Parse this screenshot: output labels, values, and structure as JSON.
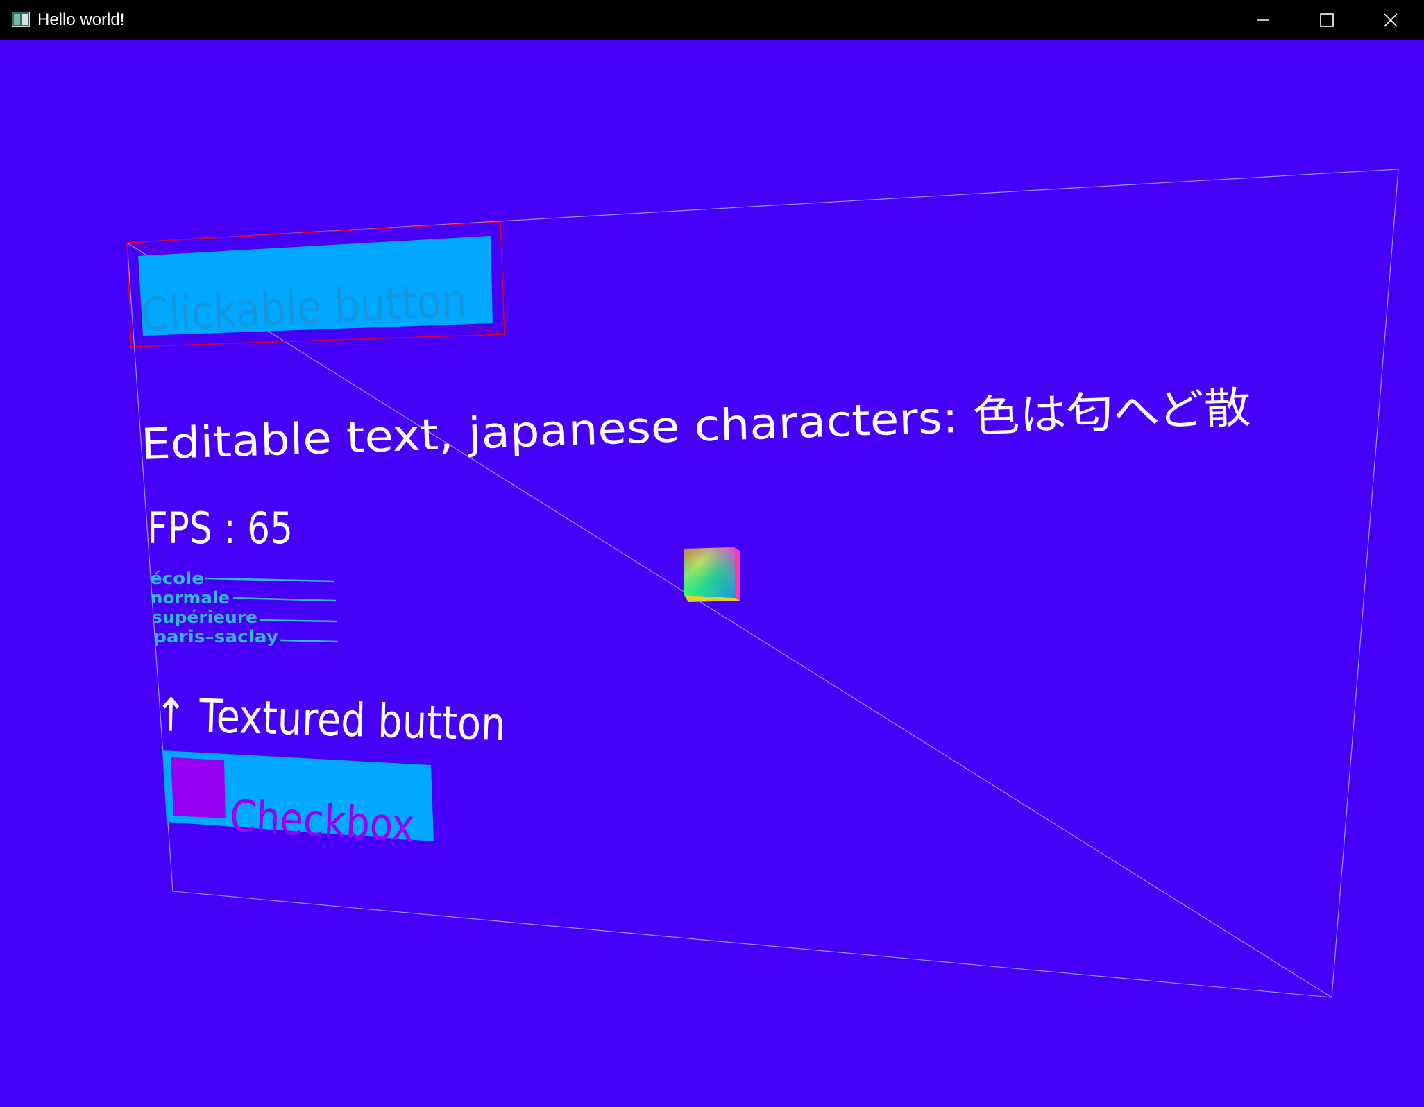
{
  "window": {
    "title": "Hello world!",
    "controls": {
      "minimize": "minimize-icon",
      "maximize": "maximize-icon",
      "close": "close-icon"
    }
  },
  "scene": {
    "clickable_button_label": "Clickable button",
    "editable_text": "Editable text, japanese characters: 色は匂へど散",
    "fps_label": "FPS : 65",
    "logo_lines": [
      "école",
      "normale",
      "supérieure",
      "paris–saclay"
    ],
    "textured_button_label": "↑ Textured button",
    "checkbox_label": "Checkbox",
    "cube": "gradient-cube"
  },
  "colors": {
    "background": "#4500f5",
    "titlebar": "#000000",
    "button_fill": "#00a8ff",
    "clickable_button_text": "#1496e0",
    "checkbox_box": "#9a00f0",
    "logo": "#33b7d6",
    "outline_red": "#d2003a",
    "wireframe": "#a9b4ff"
  }
}
